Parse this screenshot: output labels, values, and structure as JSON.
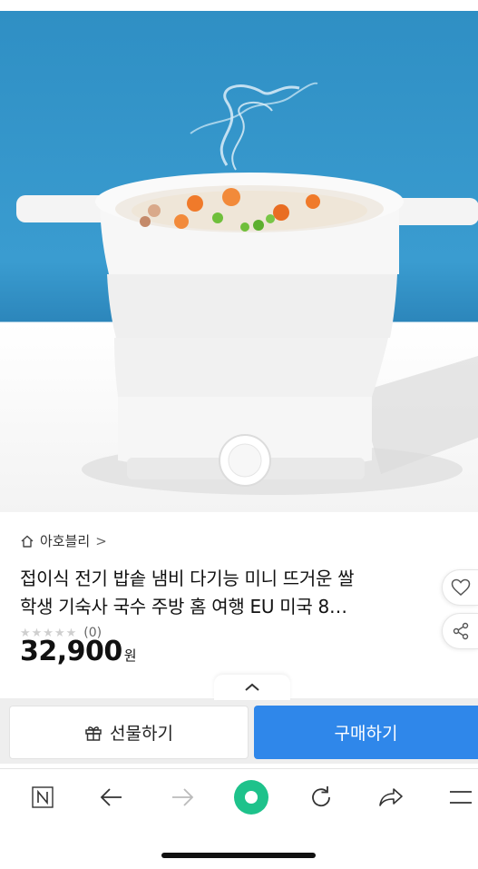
{
  "seller": {
    "name": "아호블리",
    "chevron": ">"
  },
  "product": {
    "title_line1": "접이식 전기 밥솥 냄비 다기능 미니 뜨거운 쌀",
    "title_line2": "학생 기숙사 국수 주방 홈 여행 EU 미국 8…",
    "rating_count": "(0)",
    "stars_filled": 0,
    "price": "32,900",
    "currency": "원"
  },
  "actions": {
    "gift_label": "선물하기",
    "buy_label": "구매하기"
  },
  "icons": {
    "home": "home-icon",
    "like": "heart-icon",
    "share": "share-icon",
    "collapse": "chevron-up-icon",
    "gift": "gift-icon",
    "nav_n": "naver-n-icon",
    "nav_back": "arrow-left-icon",
    "nav_forward": "arrow-right-icon",
    "nav_home": "green-dot-icon",
    "nav_reload": "reload-icon",
    "nav_share": "share-arrow-icon",
    "nav_menu": "menu-icon"
  },
  "colors": {
    "buy_button": "#2f87ea",
    "nav_home": "#1ec28b",
    "hero_sky": "#3a9cd0"
  }
}
